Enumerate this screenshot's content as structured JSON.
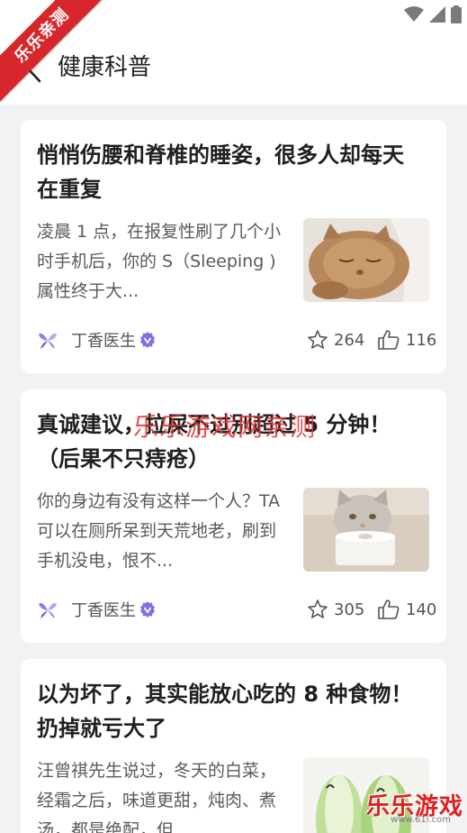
{
  "ribbon_text": "乐乐亲测",
  "header": {
    "title": "健康科普"
  },
  "articles": [
    {
      "title": "悄悄伤腰和脊椎的睡姿，很多人却每天在重复",
      "summary": "凌晨 1 点，在报复性刷了几个小时手机后，你的 S（Sleeping ) 属性终于大...",
      "source": "丁香医生",
      "favorites": "264",
      "likes": "116"
    },
    {
      "title": "真诚建议，拉屎不过别超过 5 分钟！（后果不只痔疮）",
      "summary": "你的身边有没有这样一个人？TA 可以在厕所呆到天荒地老，刷到手机没电，恨不...",
      "source": "丁香医生",
      "favorites": "305",
      "likes": "140"
    },
    {
      "title": "以为坏了，其实能放心吃的 8 种食物！扔掉就亏大了",
      "summary": "汪曾祺先生说过，冬天的白菜，经霜之后，味道更甜，炖肉、煮汤，都是绝配，但..."
    }
  ],
  "watermark": "乐乐游戏网亲测",
  "corner_logo": {
    "name": "乐乐游戏",
    "url": "www.61l.com"
  }
}
